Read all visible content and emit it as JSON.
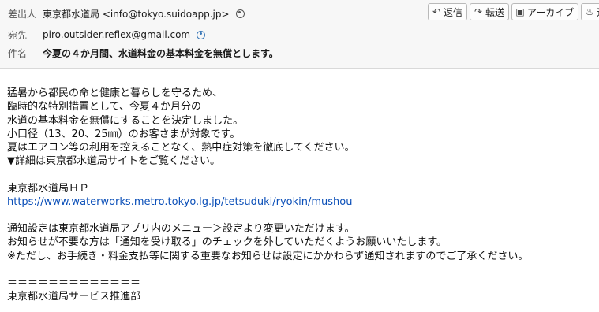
{
  "header": {
    "from_label": "差出人",
    "from_value": "東京都水道局 <info@tokyo.suidoapp.jp>",
    "to_label": "宛先",
    "to_value": "piro.outsider.reflex@gmail.com",
    "subject_label": "件名",
    "subject_value": "今夏の４か月間、水道料金の基本料金を無償とします。"
  },
  "toolbar": {
    "reply_label": "返信",
    "forward_label": "転送",
    "archive_label": "アーカイブ",
    "more_label": "迷"
  },
  "body": {
    "lines": [
      "猛暑から都民の命と健康と暮らしを守るため、",
      "臨時的な特別措置として、今夏４か月分の",
      "水道の基本料金を無償にすることを決定しました。",
      "小口径（13、20、25㎜）のお客さまが対象です。",
      "夏はエアコン等の利用を控えることなく、熱中症対策を徹底してください。",
      "▼詳細は東京都水道局サイトをご覧ください。",
      "",
      "東京都水道局ＨＰ"
    ],
    "link": "https://www.waterworks.metro.tokyo.lg.jp/tetsuduki/ryokin/mushou",
    "lines2": [
      "",
      "通知設定は東京都水道局アプリ内のメニュー＞設定より変更いただけます。",
      "お知らせが不要な方は「通知を受け取る」のチェックを外していただくようお願いいたします。",
      "※ただし、お手続き・料金支払等に関する重要なお知らせは設定にかかわらず通知されますのでご了承ください。",
      "",
      "＝＝＝＝＝＝＝＝＝＝＝＝＝",
      "東京都水道局サービス推進部"
    ]
  }
}
